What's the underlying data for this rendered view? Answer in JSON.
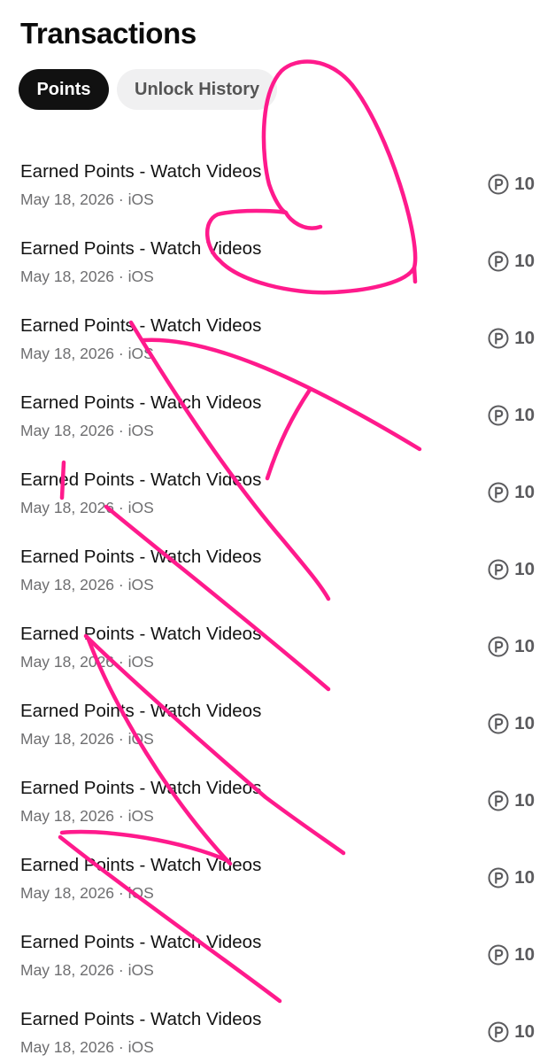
{
  "header": {
    "title": "Transactions"
  },
  "tabs": [
    {
      "label": "Points",
      "active": true
    },
    {
      "label": "Unlock History",
      "active": false
    }
  ],
  "transactions": [
    {
      "title": "Earned Points - Watch Videos",
      "date": "May 18, 2026",
      "platform": "iOS",
      "amount": "10",
      "icon": "points-coin-icon"
    },
    {
      "title": "Earned Points - Watch Videos",
      "date": "May 18, 2026",
      "platform": "iOS",
      "amount": "10",
      "icon": "points-coin-icon"
    },
    {
      "title": "Earned Points - Watch Videos",
      "date": "May 18, 2026",
      "platform": "iOS",
      "amount": "10",
      "icon": "points-coin-icon"
    },
    {
      "title": "Earned Points - Watch Videos",
      "date": "May 18, 2026",
      "platform": "iOS",
      "amount": "10",
      "icon": "points-coin-icon"
    },
    {
      "title": "Earned Points - Watch Videos",
      "date": "May 18, 2026",
      "platform": "iOS",
      "amount": "10",
      "icon": "points-coin-icon"
    },
    {
      "title": "Earned Points - Watch Videos",
      "date": "May 18, 2026",
      "platform": "iOS",
      "amount": "10",
      "icon": "points-coin-icon"
    },
    {
      "title": "Earned Points - Watch Videos",
      "date": "May 18, 2026",
      "platform": "iOS",
      "amount": "10",
      "icon": "points-coin-icon"
    },
    {
      "title": "Earned Points - Watch Videos",
      "date": "May 18, 2026",
      "platform": "iOS",
      "amount": "10",
      "icon": "points-coin-icon"
    },
    {
      "title": "Earned Points - Watch Videos",
      "date": "May 18, 2026",
      "platform": "iOS",
      "amount": "10",
      "icon": "points-coin-icon"
    },
    {
      "title": "Earned Points - Watch Videos",
      "date": "May 18, 2026",
      "platform": "iOS",
      "amount": "10",
      "icon": "points-coin-icon"
    },
    {
      "title": "Earned Points - Watch Videos",
      "date": "May 18, 2026",
      "platform": "iOS",
      "amount": "10",
      "icon": "points-coin-icon"
    },
    {
      "title": "Earned Points - Watch Videos",
      "date": "May 18, 2026",
      "platform": "iOS",
      "amount": "10",
      "icon": "points-coin-icon"
    }
  ],
  "subtitle_separator": " · ",
  "colors": {
    "active_tab_bg": "#111111",
    "inactive_tab_bg": "#f0f0f1",
    "annotation_ink": "#ff1a8c",
    "secondary_text": "#6e6e70",
    "amount_text": "#5b5b5e"
  }
}
